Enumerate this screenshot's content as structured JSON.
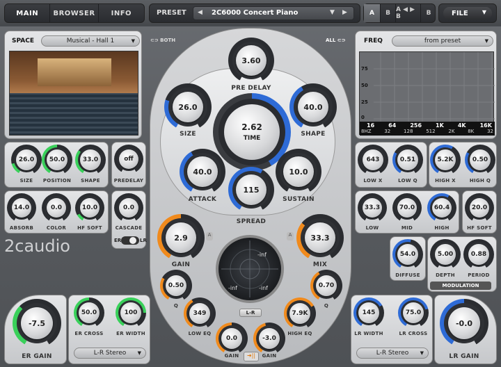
{
  "tabs": [
    "MAIN",
    "BROWSER",
    "INFO"
  ],
  "preset": {
    "label": "PRESET",
    "name": "2C6000 Concert Piano",
    "prev": "◀",
    "next": "▶",
    "arrow": "▼"
  },
  "ab": [
    "A",
    "B",
    "A ◀ ▶ B",
    "B"
  ],
  "file": {
    "label": "FILE",
    "arrow": "▼"
  },
  "space": {
    "label": "SPACE",
    "selected": "Musical - Hall 1"
  },
  "both_label": "BOTH",
  "all_label": "ALL",
  "freq": {
    "label": "FREQ",
    "selected": "from preset"
  },
  "eq_ticks": [
    "75",
    "50",
    "25",
    "0"
  ],
  "eq_freq_row1": [
    "16",
    "64",
    "256",
    "1K",
    "4K",
    "16K"
  ],
  "eq_freq_row2": [
    "8HZ",
    "32",
    "128",
    "512",
    "2K",
    "8K",
    "32"
  ],
  "logo": "2caudio",
  "toggle": {
    "left": "ER",
    "right": "LR"
  },
  "modulation_label": "MODULATION",
  "center_time": {
    "value": "2.62",
    "label": "TIME"
  },
  "scope": {
    "top": "-inf",
    "left": "-inf",
    "right": "-inf",
    "bottom_label": "L-R",
    "bottom_val": "-inf"
  },
  "knobs": {
    "size_l": {
      "v": "26.0",
      "l": "SIZE"
    },
    "position": {
      "v": "50.0",
      "l": "POSITION"
    },
    "shape_l": {
      "v": "33.0",
      "l": "SHAPE"
    },
    "predelay_l": {
      "v": "off",
      "l": "PREDELAY"
    },
    "absorb": {
      "v": "14.0",
      "l": "ABSORB"
    },
    "color": {
      "v": "0.0",
      "l": "COLOR"
    },
    "hfsoft_l": {
      "v": "10.0",
      "l": "HF SOFT"
    },
    "cascade": {
      "v": "0.0",
      "l": "CASCADE"
    },
    "pre_delay": {
      "v": "3.60",
      "l": "PRE DELAY"
    },
    "size_c": {
      "v": "26.0",
      "l": "SIZE"
    },
    "shape_c": {
      "v": "40.0",
      "l": "SHAPE"
    },
    "attack": {
      "v": "40.0",
      "l": "ATTACK"
    },
    "sustain": {
      "v": "10.0",
      "l": "SUSTAIN"
    },
    "spread": {
      "v": "115",
      "l": "SPREAD"
    },
    "gain_l": {
      "v": "2.9",
      "l": "GAIN"
    },
    "mix": {
      "v": "33.3",
      "l": "MIX"
    },
    "q_l": {
      "v": "0.50",
      "l": "Q"
    },
    "q_r": {
      "v": "0.70",
      "l": "Q"
    },
    "low_eq": {
      "v": "349",
      "l": "LOW EQ"
    },
    "high_eq": {
      "v": "7.9K",
      "l": "HIGH EQ"
    },
    "gain_bl": {
      "v": "0.0",
      "l": "GAIN"
    },
    "gain_br": {
      "v": "-3.0",
      "l": "GAIN"
    },
    "low_x": {
      "v": "643",
      "l": "LOW X"
    },
    "low_q": {
      "v": "0.51",
      "l": "LOW Q"
    },
    "high_x": {
      "v": "5.2K",
      "l": "HIGH X"
    },
    "high_q": {
      "v": "0.50",
      "l": "HIGH Q"
    },
    "low": {
      "v": "33.3",
      "l": "LOW"
    },
    "mid": {
      "v": "70.0",
      "l": "MID"
    },
    "high": {
      "v": "60.4",
      "l": "HIGH"
    },
    "hf_soft_r": {
      "v": "20.0",
      "l": "HF SOFT"
    },
    "diffuse": {
      "v": "54.0",
      "l": "DIFFUSE"
    },
    "depth": {
      "v": "5.00",
      "l": "DEPTH"
    },
    "period": {
      "v": "0.88",
      "l": "PERIOD"
    },
    "er_gain": {
      "v": "-7.5",
      "l": "ER GAIN"
    },
    "er_cross": {
      "v": "50.0",
      "l": "ER CROSS"
    },
    "er_width": {
      "v": "100",
      "l": "ER WIDTH"
    },
    "lr_width": {
      "v": "145",
      "l": "LR WIDTH"
    },
    "lr_cross": {
      "v": "75.0",
      "l": "LR CROSS"
    },
    "lr_gain": {
      "v": "-0.0",
      "l": "LR GAIN"
    }
  },
  "er_mode": "L-R Stereo",
  "lr_mode": "L-R Stereo",
  "colors": {
    "green": "#39d05a",
    "blue": "#2e6bd6",
    "orange": "#f08a1c",
    "dark": "#2a2c30"
  }
}
